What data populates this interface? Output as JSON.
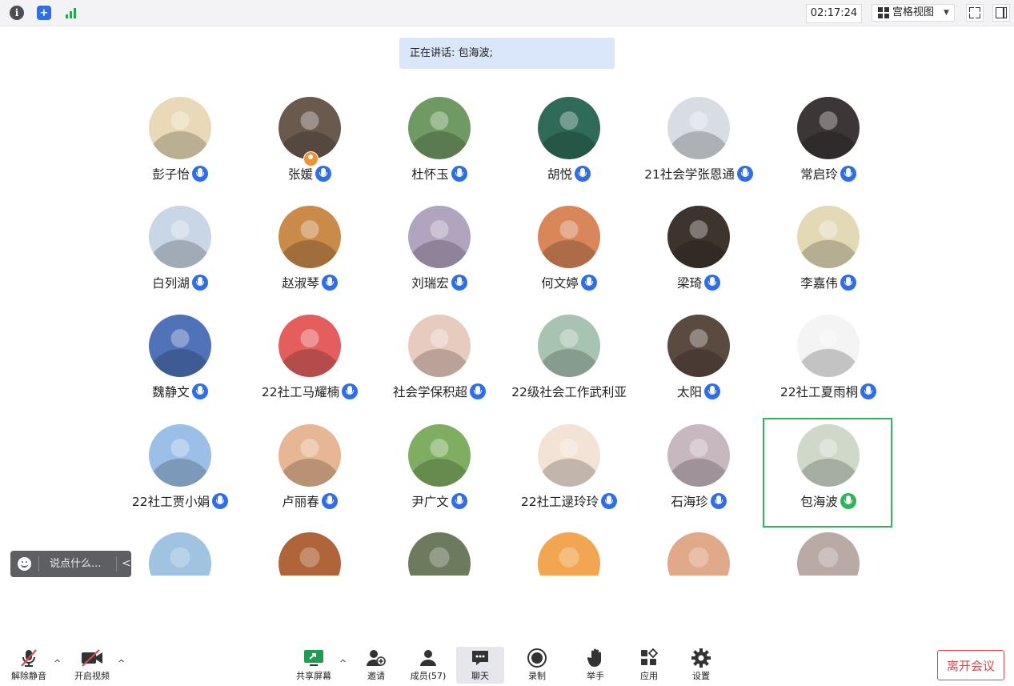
{
  "topbar": {
    "timer": "02:17:24",
    "view_mode": "宫格视图",
    "icons": [
      "info-icon",
      "shield-icon",
      "signal-icon",
      "fullscreen-icon",
      "side-panel-icon"
    ]
  },
  "speaking_banner": "正在讲话: 包海波;",
  "participants": [
    {
      "name": "彭子怡",
      "mic": true,
      "avatar_color": "#e9d9b8"
    },
    {
      "name": "张媛",
      "mic": true,
      "avatar_color": "#6a5a4d",
      "host": true
    },
    {
      "name": "杜怀玉",
      "mic": true,
      "avatar_color": "#6f9a63"
    },
    {
      "name": "胡悦",
      "mic": true,
      "avatar_color": "#2f6b58"
    },
    {
      "name": "21社会学张恩通",
      "mic": true,
      "avatar_color": "#d8dde3"
    },
    {
      "name": "常启玲",
      "mic": true,
      "avatar_color": "#3c3636"
    },
    {
      "name": "白列湖",
      "mic": true,
      "avatar_color": "#c9d6e6"
    },
    {
      "name": "赵淑琴",
      "mic": true,
      "avatar_color": "#c98a4a"
    },
    {
      "name": "刘瑞宏",
      "mic": true,
      "avatar_color": "#b1a4be"
    },
    {
      "name": "何文婷",
      "mic": true,
      "avatar_color": "#d9865a"
    },
    {
      "name": "梁琦",
      "mic": true,
      "avatar_color": "#3d342e"
    },
    {
      "name": "李嘉伟",
      "mic": true,
      "avatar_color": "#e4d9b5"
    },
    {
      "name": "魏静文",
      "mic": true,
      "avatar_color": "#4f72b8"
    },
    {
      "name": "22社工马耀楠",
      "mic": true,
      "avatar_color": "#e45e5e"
    },
    {
      "name": "社会学保积超",
      "mic": true,
      "avatar_color": "#e8cbbf"
    },
    {
      "name": "22级社会工作武利亚",
      "mic": false,
      "avatar_color": "#a8c3b1"
    },
    {
      "name": "太阳",
      "mic": true,
      "avatar_color": "#5b4a40"
    },
    {
      "name": "22社工夏雨桐",
      "mic": true,
      "avatar_color": "#f4f4f4"
    },
    {
      "name": "22社工贾小娟",
      "mic": true,
      "avatar_color": "#9cbfe8"
    },
    {
      "name": "卢丽春",
      "mic": true,
      "avatar_color": "#e7b694"
    },
    {
      "name": "尹广文",
      "mic": true,
      "avatar_color": "#7fae62"
    },
    {
      "name": "22社工逯玲玲",
      "mic": true,
      "avatar_color": "#f3e2d6"
    },
    {
      "name": "石海珍",
      "mic": true,
      "avatar_color": "#c7b7bf"
    },
    {
      "name": "包海波",
      "mic": true,
      "avatar_color": "#cfd8c9",
      "speaking": true
    }
  ],
  "partial_row_colors": [
    "#9fc3e0",
    "#b0643a",
    "#6d7a5e",
    "#f2a651",
    "#e0a98a",
    "#b9aaa6"
  ],
  "chat": {
    "placeholder": "说点什么..."
  },
  "toolbar": {
    "unmute": "解除静音",
    "start_video": "开启视频",
    "share_screen": "共享屏幕",
    "invite": "邀请",
    "members": "成员(57)",
    "chat": "聊天",
    "record": "录制",
    "raise_hand": "举手",
    "apps": "应用",
    "settings": "设置",
    "leave": "离开会议"
  },
  "colors": {
    "accent_blue": "#2f6ee6",
    "speaking_green": "#2fb45a",
    "leave_red": "#e0474b",
    "banner_bg": "#dae7fb"
  }
}
